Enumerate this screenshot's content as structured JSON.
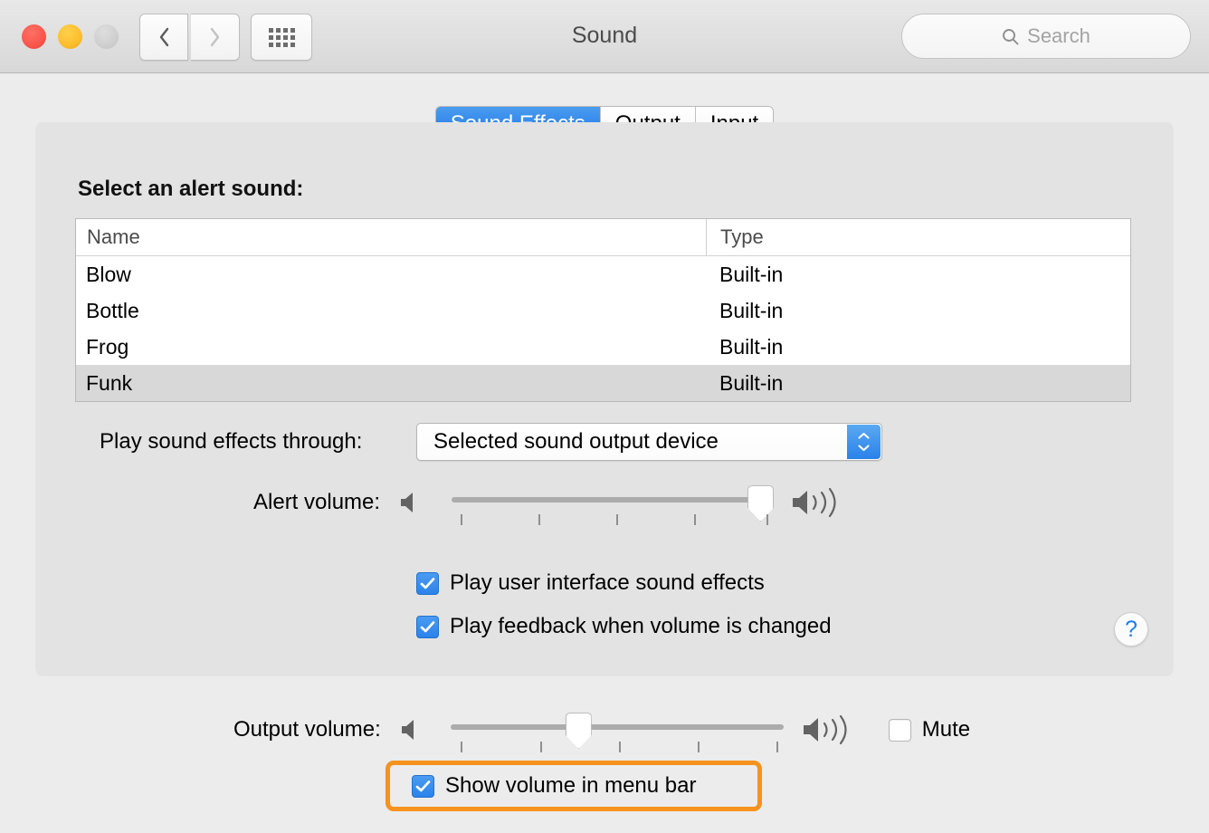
{
  "window": {
    "title": "Sound",
    "traffic_lights": [
      "close-red",
      "minimize-yellow",
      "zoom-grey-disabled"
    ],
    "back_icon": "chevron-left-icon",
    "forward_icon": "chevron-right-icon",
    "grid_icon": "show-all-grid-icon"
  },
  "search": {
    "placeholder": "Search",
    "icon": "search-icon"
  },
  "tabs": [
    {
      "label": "Sound Effects",
      "selected": true
    },
    {
      "label": "Output",
      "selected": false
    },
    {
      "label": "Input",
      "selected": false
    }
  ],
  "sound_effects": {
    "section_label": "Select an alert sound:",
    "table": {
      "columns": [
        "Name",
        "Type"
      ],
      "rows": [
        {
          "name": "Blow",
          "type": "Built-in",
          "selected": false
        },
        {
          "name": "Bottle",
          "type": "Built-in",
          "selected": false
        },
        {
          "name": "Frog",
          "type": "Built-in",
          "selected": false
        },
        {
          "name": "Funk",
          "type": "Built-in",
          "selected": true
        }
      ]
    },
    "play_through": {
      "label": "Play sound effects through:",
      "value": "Selected sound output device",
      "stepper_icon": "chevron-up-down-icon"
    },
    "alert_volume": {
      "label": "Alert volume:",
      "value_percent": 94,
      "min_icon": "speaker-mute-icon",
      "max_icon": "speaker-loud-icon",
      "tick_count": 5
    },
    "checkboxes": [
      {
        "label": "Play user interface sound effects",
        "checked": true
      },
      {
        "label": "Play feedback when volume is changed",
        "checked": true
      }
    ],
    "help_label": "?"
  },
  "output_volume": {
    "label": "Output volume:",
    "value_percent": 38,
    "min_icon": "speaker-mute-icon",
    "max_icon": "speaker-loud-icon",
    "tick_count": 5,
    "mute": {
      "label": "Mute",
      "checked": false
    }
  },
  "menu_bar_option": {
    "label": "Show volume in menu bar",
    "checked": true,
    "highlighted": true,
    "highlight_color": "#f6921e"
  },
  "colors": {
    "accent_blue": "#2b82ea",
    "selected_tab_blue": "#1d72e8",
    "highlight_orange": "#f6921e",
    "window_background": "#ececec",
    "panel_background": "#e3e3e3",
    "row_selected": "#d8d8d8"
  }
}
